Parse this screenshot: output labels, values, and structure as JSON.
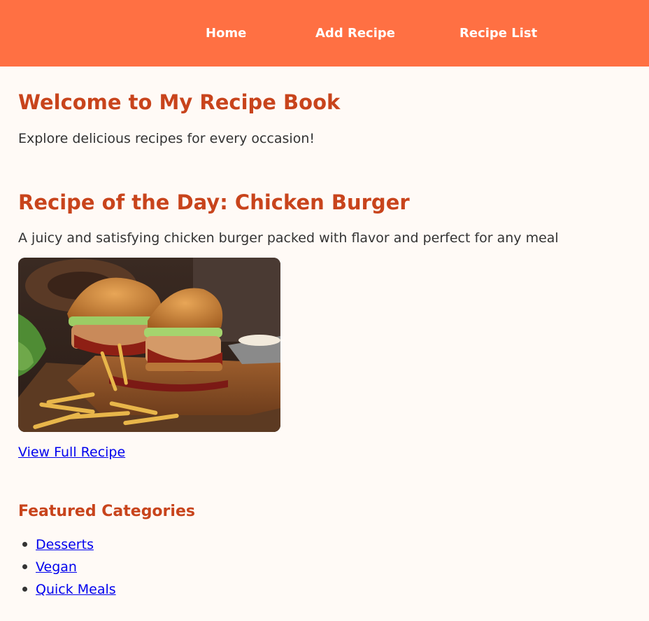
{
  "nav": {
    "items": [
      {
        "label": "Home"
      },
      {
        "label": "Add Recipe"
      },
      {
        "label": "Recipe List"
      }
    ]
  },
  "hero": {
    "title": "Welcome to My Recipe Book",
    "tagline": "Explore delicious recipes for every occasion!"
  },
  "recipe_of_day": {
    "title": "Recipe of the Day: Chicken Burger",
    "description": "A juicy and satisfying chicken burger packed with flavor and perfect for any meal",
    "link_label": "View Full Recipe"
  },
  "featured": {
    "title": "Featured Categories",
    "categories": [
      {
        "label": "Desserts"
      },
      {
        "label": "Vegan"
      },
      {
        "label": "Quick Meals"
      }
    ]
  },
  "colors": {
    "nav_background": "#ff7043",
    "heading": "#c8441c",
    "page_background": "#fffaf6",
    "link": "#0000ee"
  }
}
